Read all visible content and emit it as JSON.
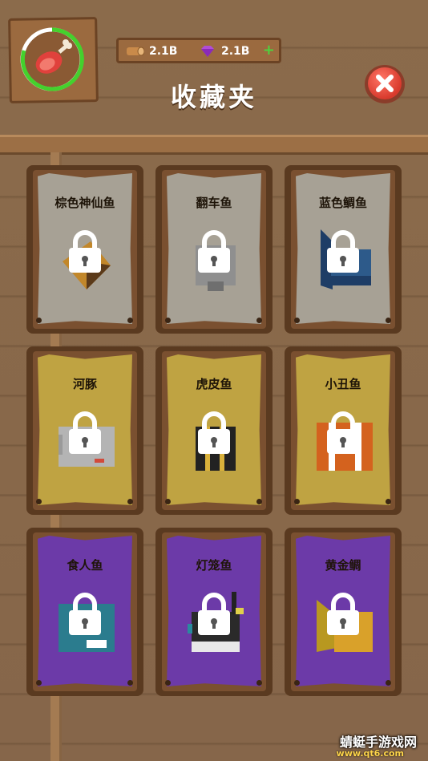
{
  "header": {
    "title": "收藏夹",
    "wood_amount": "2.1B",
    "gem_amount": "2.1B",
    "add_label": "+"
  },
  "collection": [
    {
      "name": "棕色神仙鱼",
      "tier": "gray",
      "fish_color": "#c2872a",
      "locked": true
    },
    {
      "name": "翻车鱼",
      "tier": "gray",
      "fish_color": "#8f8f8f",
      "locked": true
    },
    {
      "name": "蓝色鲷鱼",
      "tier": "gray",
      "fish_color": "#2d5a8a",
      "locked": true
    },
    {
      "name": "河豚",
      "tier": "gold",
      "fish_color": "#b4b4b4",
      "locked": true
    },
    {
      "name": "虎皮鱼",
      "tier": "gold",
      "fish_color": "#222222",
      "locked": true
    },
    {
      "name": "小丑鱼",
      "tier": "gold",
      "fish_color": "#d4621e",
      "locked": true
    },
    {
      "name": "食人鱼",
      "tier": "purple",
      "fish_color": "#2b7c8e",
      "locked": true
    },
    {
      "name": "灯笼鱼",
      "tier": "purple",
      "fish_color": "#2a2a2a",
      "locked": true
    },
    {
      "name": "黄金鲷",
      "tier": "purple",
      "fish_color": "#d9a12a",
      "locked": true
    }
  ],
  "watermark": {
    "text": "蜻蜓手游戏网",
    "url": "www.qt6.com"
  },
  "colors": {
    "wood_dark": "#6b4324",
    "wood": "#9b6a3f",
    "progress_ring": "#44d12d",
    "close_red": "#d83a2d"
  }
}
